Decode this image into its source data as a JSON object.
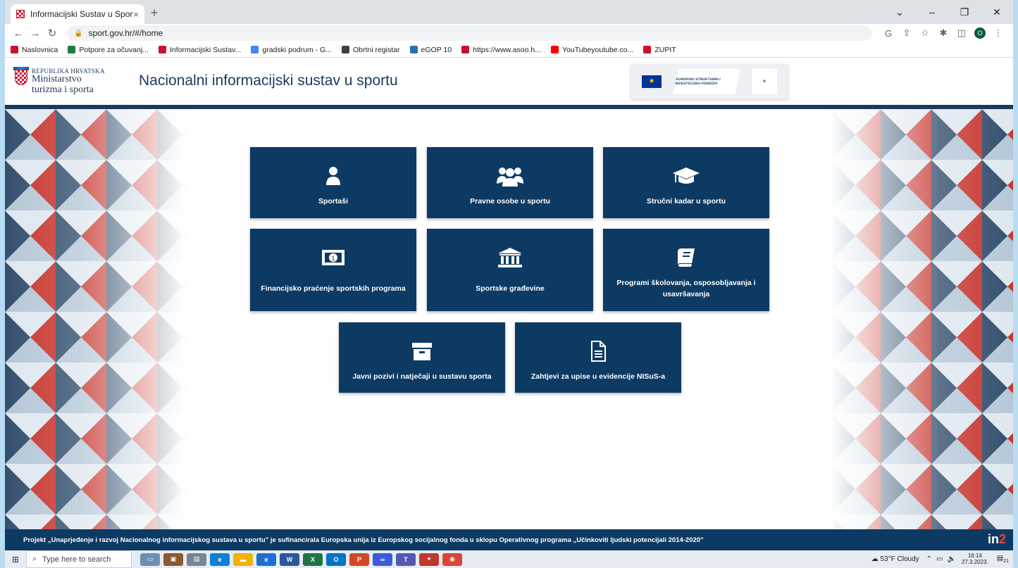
{
  "browser": {
    "tab_title": "Informacijski Sustav u Sportu",
    "tab_close": "×",
    "new_tab": "+",
    "url": "sport.gov.hr/#/home",
    "window_controls": [
      "⌄",
      "–",
      "❐",
      "✕"
    ],
    "bookmarks": [
      {
        "label": "Naslovnica",
        "color": "#d0112b"
      },
      {
        "label": "Potpore za očuvanj...",
        "color": "#1e7c45"
      },
      {
        "label": "Informacijski Sustav...",
        "color": "#d0112b"
      },
      {
        "label": "gradski podrum - G...",
        "color": "#4285f4"
      },
      {
        "label": "Obrtni registar",
        "color": "#3c4043"
      },
      {
        "label": "eGOP 10",
        "color": "#2a6fb4"
      },
      {
        "label": "https://www.asoo.h...",
        "color": "#c8102e"
      },
      {
        "label": "YouTubeyoutube.co...",
        "color": "#ff0000"
      },
      {
        "label": "ZUPIT",
        "color": "#d0112b"
      }
    ],
    "profile_initial": "O"
  },
  "header": {
    "republic": "REPUBLIKA HRVATSKA",
    "ministry_line1": "Ministarstvo",
    "ministry_line2": "turizma i sporta",
    "title": "Nacionalni informacijski sustav u sportu",
    "eu_mid_text": "EUROPSKI STRUKTURNI I INVESTICIJSKI FONDOVI"
  },
  "tiles": [
    {
      "label": "Sportaši",
      "icon": "user-icon"
    },
    {
      "label": "Pravne osobe u sportu",
      "icon": "users-icon"
    },
    {
      "label": "Stručni kadar u sportu",
      "icon": "graduation-cap-icon"
    },
    {
      "label": "Financijsko praćenje sportskih programa",
      "icon": "money-bill-icon"
    },
    {
      "label": "Sportske građevine",
      "icon": "landmark-icon"
    },
    {
      "label": "Programi školovanja, osposobljavanja i usavršavanja",
      "icon": "book-icon"
    },
    {
      "label": "Javni pozivi i natječaji u sustavu sporta",
      "icon": "archive-icon"
    },
    {
      "label": "Zahtjevi za upise u evidencije NISuS-a",
      "icon": "file-alt-icon"
    }
  ],
  "footer": {
    "text": "Projekt „Unaprjeđenje i razvoj Nacionalnog informacijskog sustava u sportu\" je sufinancirala Europska unija iz Europskog socijalnog fonda u sklopu Operativnog programa „Učinkoviti ljudski potencijali 2014-2020\"",
    "logo_in": "in",
    "logo_2": "2"
  },
  "taskbar": {
    "search_placeholder": "Type here to search",
    "weather": "53°F  Cloudy",
    "time": "16:14",
    "date": "27.3.2023.",
    "notif_count": "21"
  },
  "colors": {
    "tile": "#0d3a63",
    "header_text": "#1a3a5c",
    "accent_red": "#d0112b"
  }
}
